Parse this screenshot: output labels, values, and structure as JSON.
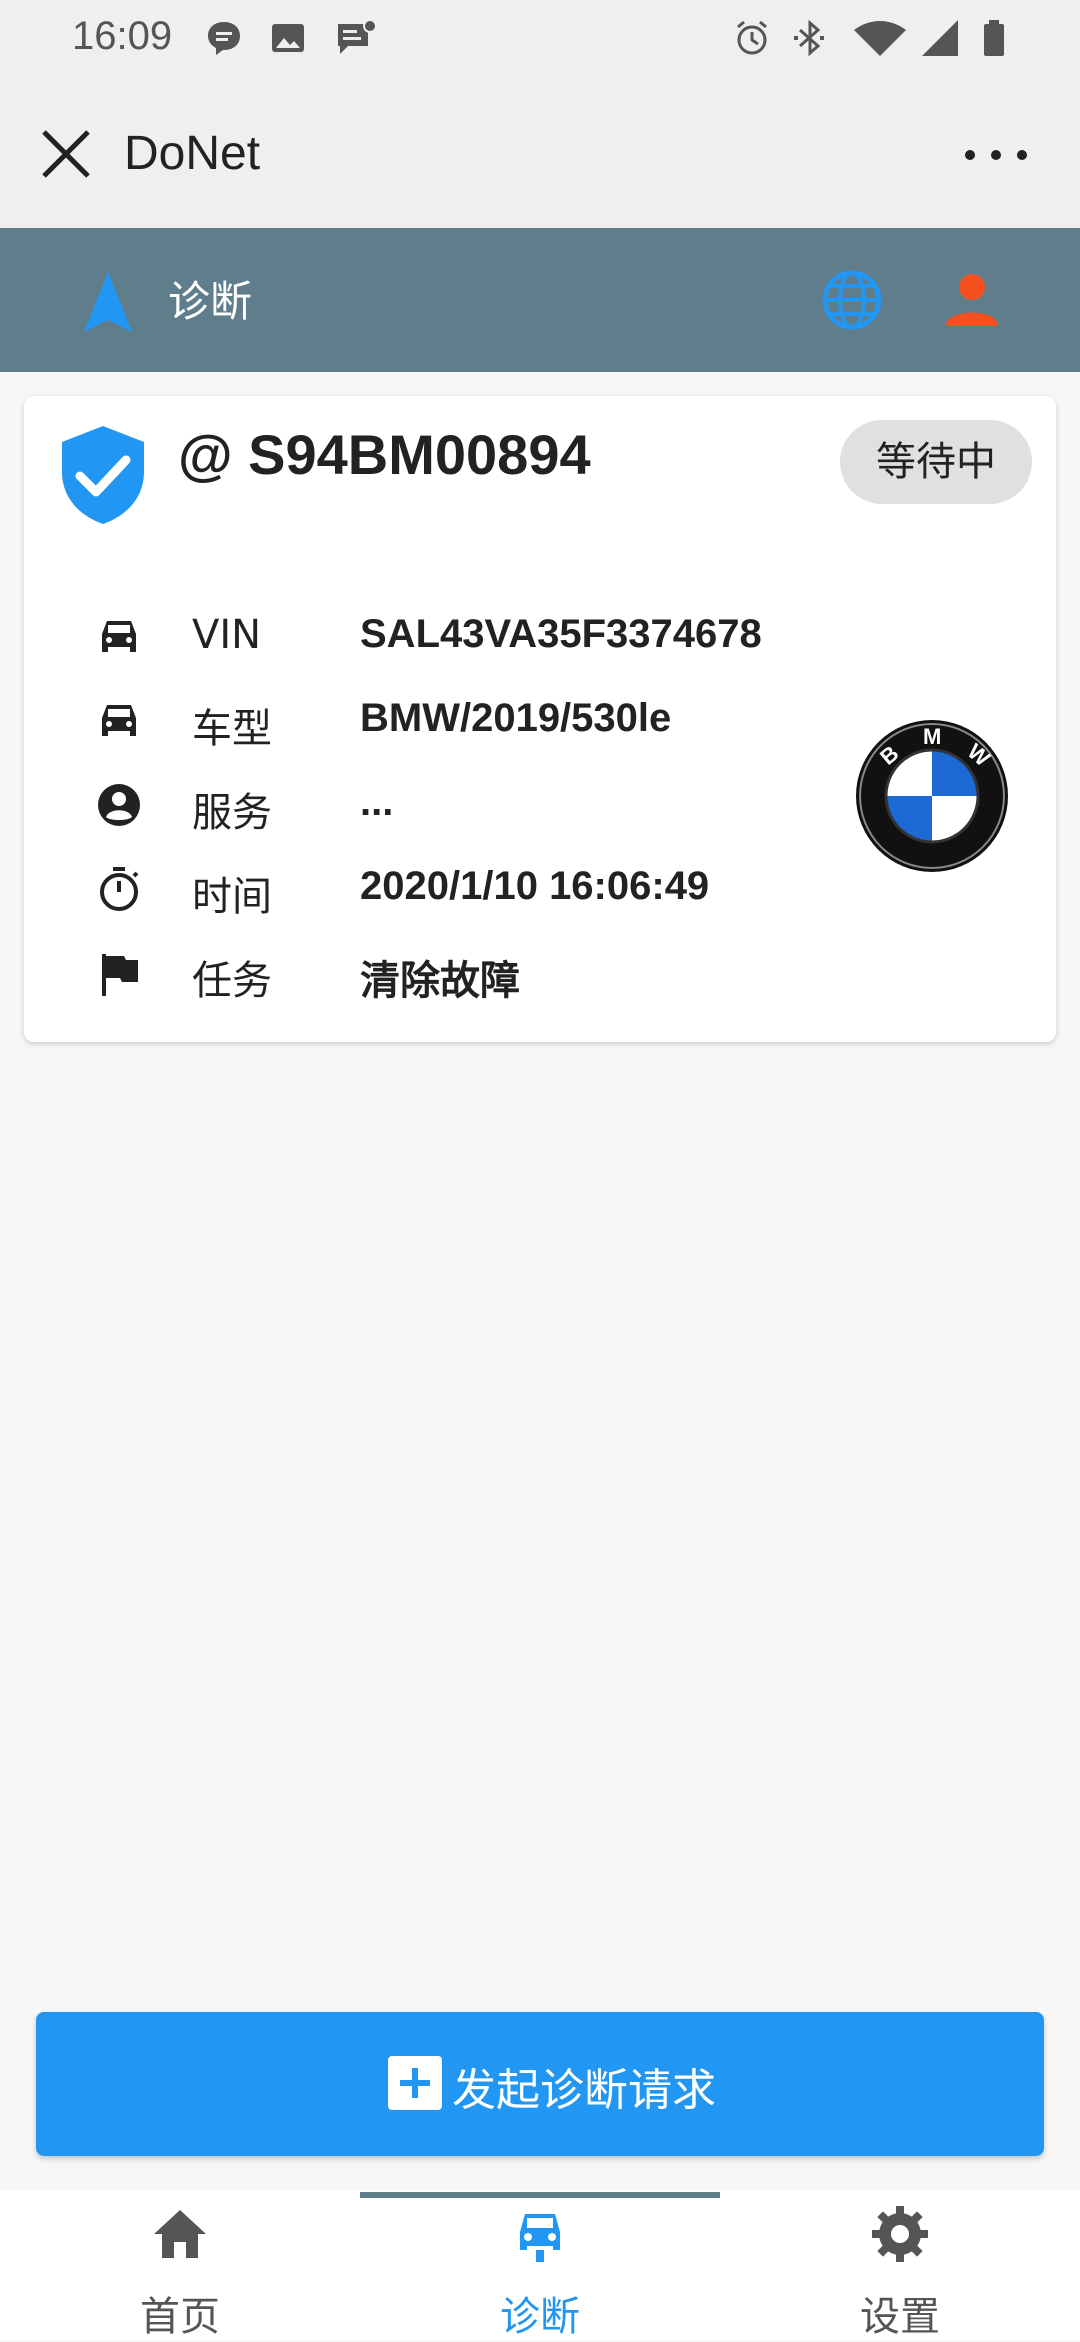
{
  "status_bar": {
    "time": "16:09",
    "left_icons": [
      "message-icon",
      "image-icon",
      "notification-icon"
    ],
    "right_icons": [
      "alarm-icon",
      "bluetooth-icon",
      "wifi-icon",
      "signal-icon",
      "battery-icon"
    ]
  },
  "title_bar": {
    "title": "DoNet",
    "close_icon": "close-icon",
    "more_icon": "more-icon"
  },
  "nav_bar": {
    "title": "诊断",
    "colors": {
      "background": "#607d8b",
      "globe": "#2196f3",
      "user": "#f4511e"
    }
  },
  "card": {
    "plate": "@ S94BM00894",
    "status": "等待中",
    "rows": [
      {
        "icon": "car-icon",
        "label": "VIN",
        "value": "SAL43VA35F3374678"
      },
      {
        "icon": "car-icon",
        "label": "车型",
        "value": "BMW/2019/530le"
      },
      {
        "icon": "user-circle-icon",
        "label": "服务",
        "value": "..."
      },
      {
        "icon": "timer-icon",
        "label": "时间",
        "value": "2020/1/10 16:06:49"
      },
      {
        "icon": "flag-icon",
        "label": "任务",
        "value": "清除故障"
      }
    ],
    "brand_logo": {
      "letters": "BMW"
    }
  },
  "cta": {
    "label": "发起诊断请求",
    "color": "#2196f3"
  },
  "tabs": [
    {
      "label": "首页",
      "icon": "home-icon",
      "active": false
    },
    {
      "label": "诊断",
      "icon": "car-front-icon",
      "active": true
    },
    {
      "label": "设置",
      "icon": "gear-icon",
      "active": false
    }
  ]
}
